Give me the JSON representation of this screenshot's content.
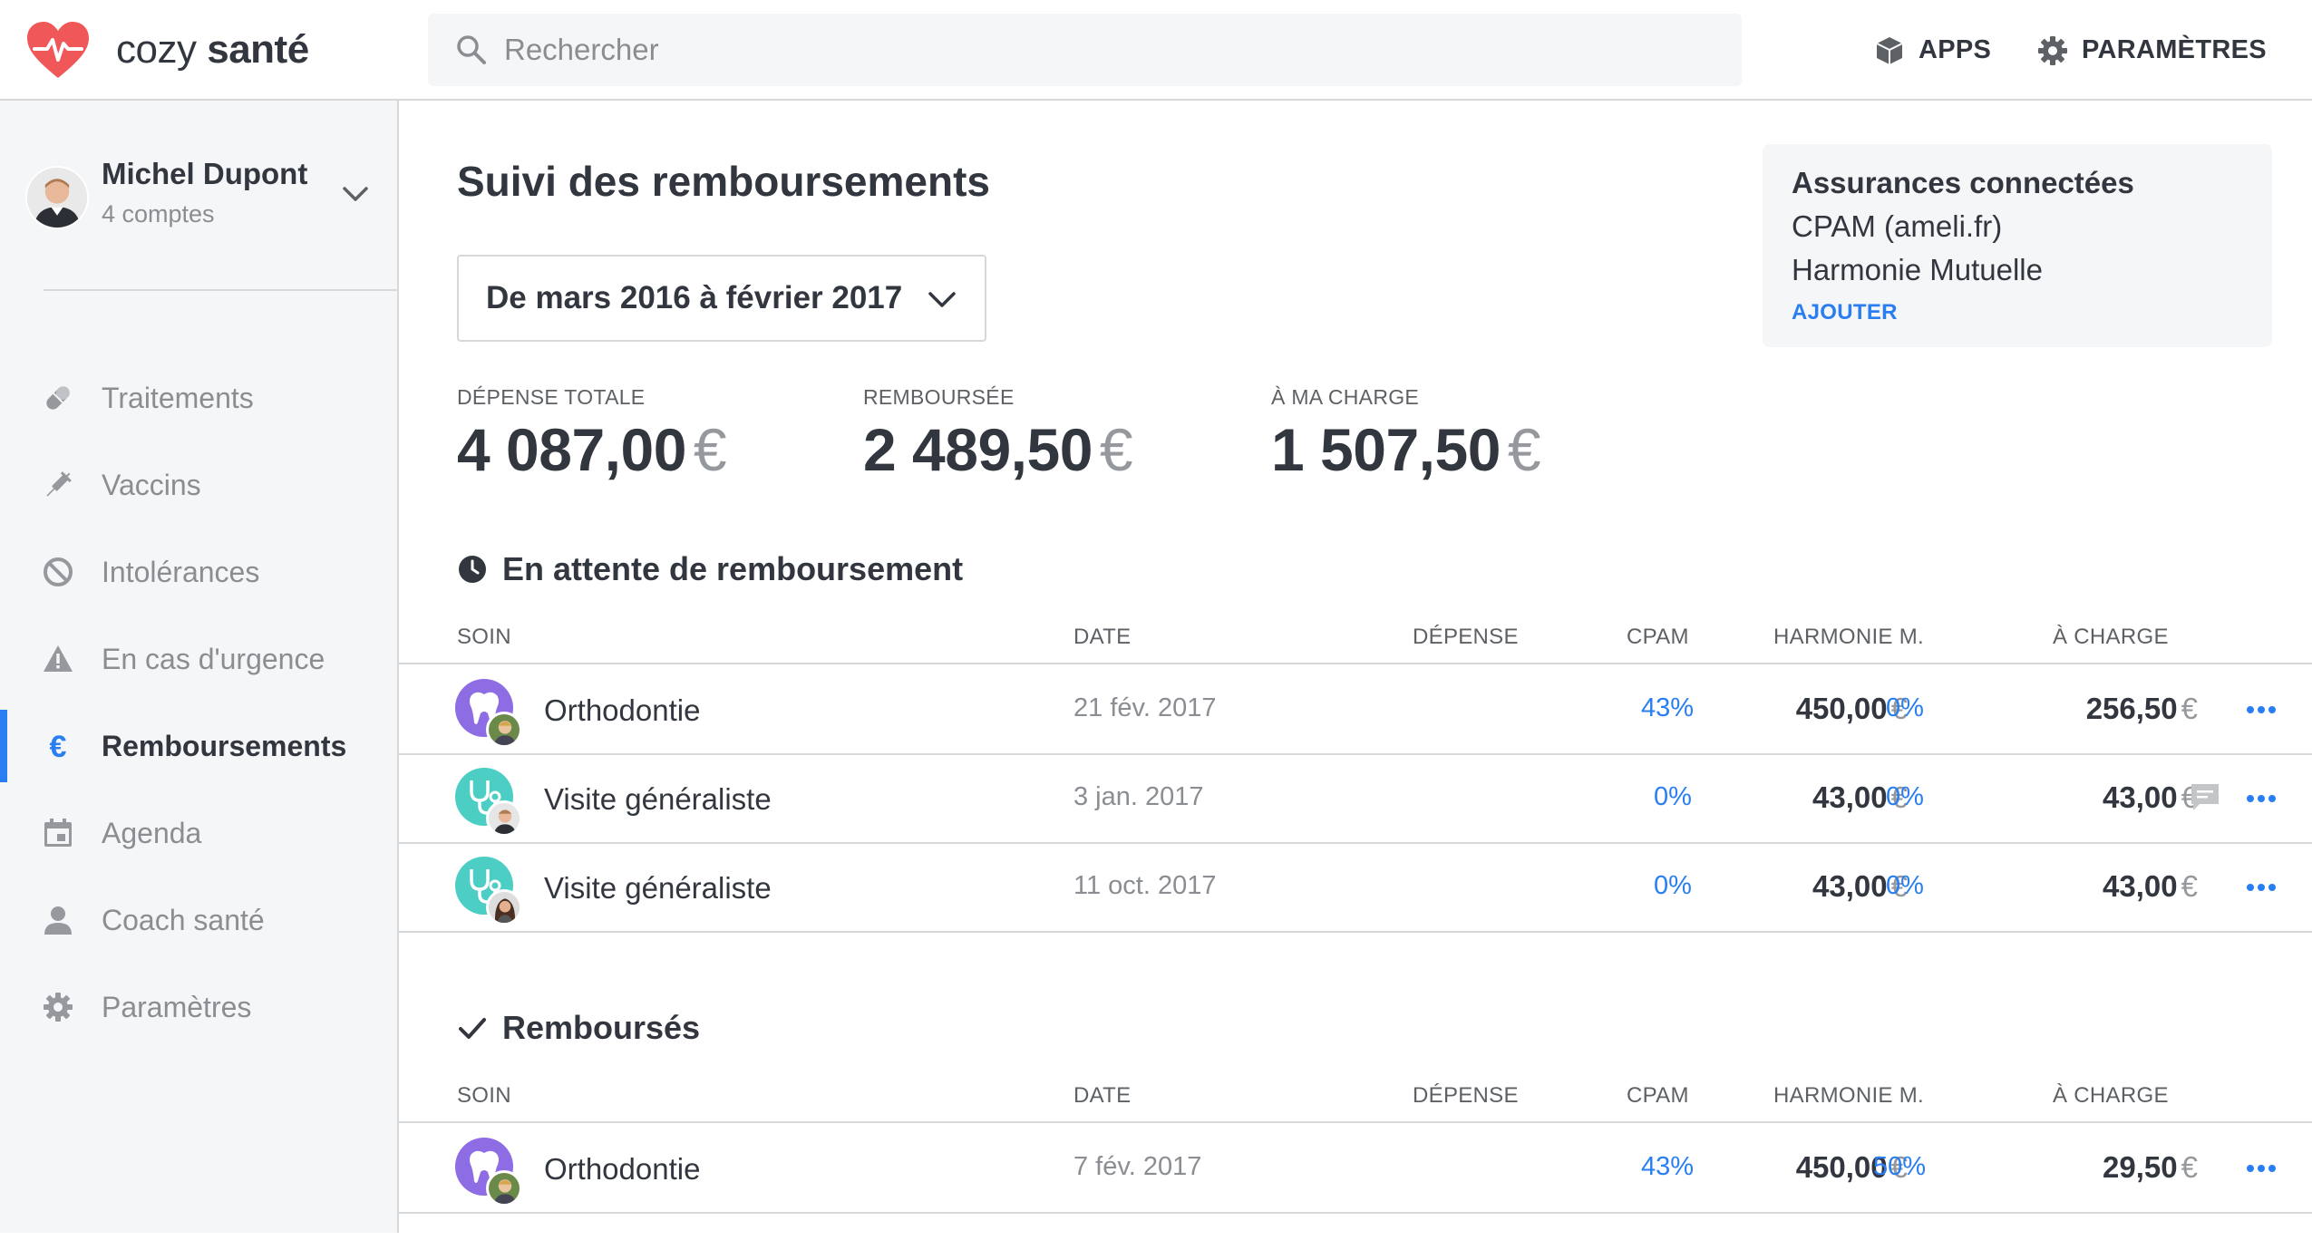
{
  "app": {
    "name_light": "cozy",
    "name_bold": "santé",
    "search_placeholder": "Rechercher",
    "apps_label": "APPS",
    "settings_label": "PARAMÈTRES",
    "accent_color": "#297ef2",
    "brand_color": "#f05759"
  },
  "profile": {
    "name": "Michel Dupont",
    "accounts": "4 comptes"
  },
  "sidebar": {
    "items": [
      {
        "label": "Traitements",
        "icon": "pill-icon",
        "active": false
      },
      {
        "label": "Vaccins",
        "icon": "syringe-icon",
        "active": false
      },
      {
        "label": "Intolérances",
        "icon": "forbidden-icon",
        "active": false
      },
      {
        "label": "En cas d'urgence",
        "icon": "warning-icon",
        "active": false
      },
      {
        "label": "Remboursements",
        "icon": "euro-icon",
        "active": true
      },
      {
        "label": "Agenda",
        "icon": "calendar-icon",
        "active": false
      },
      {
        "label": "Coach santé",
        "icon": "person-icon",
        "active": false
      },
      {
        "label": "Paramètres",
        "icon": "gear-icon",
        "active": false
      }
    ]
  },
  "main": {
    "title": "Suivi des remboursements",
    "period": "De mars 2016 à février 2017",
    "insurance": {
      "title": "Assurances connectées",
      "items": [
        "CPAM (ameli.fr)",
        "Harmonie Mutuelle"
      ],
      "add_label": "AJOUTER"
    },
    "stats": [
      {
        "label": "DÉPENSE TOTALE",
        "value": "4 087,00",
        "currency": "€"
      },
      {
        "label": "REMBOURSÉE",
        "value": "2 489,50",
        "currency": "€"
      },
      {
        "label": "À MA CHARGE",
        "value": "1 507,50",
        "currency": "€"
      }
    ],
    "columns": {
      "soin": "SOIN",
      "date": "DATE",
      "depense": "DÉPENSE",
      "cpam": "CPAM",
      "harmonie": "HARMONIE M.",
      "charge": "À CHARGE"
    },
    "pending": {
      "title": "En attente de remboursement",
      "rows": [
        {
          "soin": "Orthodontie",
          "date": "21 fév. 2017",
          "depense": "450,00",
          "cpam": "43%",
          "harmonie": "0%",
          "charge": "256,50",
          "currency": "€",
          "icon": "tooth-icon",
          "color": "#8e6ce3"
        },
        {
          "soin": "Visite généraliste",
          "date": "3 jan. 2017",
          "depense": "43,00",
          "cpam": "0%",
          "harmonie": "0%",
          "charge": "43,00",
          "currency": "€",
          "icon": "stethoscope-icon",
          "color": "#4dcec5"
        },
        {
          "soin": "Visite généraliste",
          "date": "11 oct. 2017",
          "depense": "43,00",
          "cpam": "0%",
          "harmonie": "0%",
          "charge": "43,00",
          "currency": "€",
          "icon": "stethoscope-icon",
          "color": "#4dcec5"
        }
      ]
    },
    "reimbursed": {
      "title": "Remboursés",
      "rows": [
        {
          "soin": "Orthodontie",
          "date": "7 fév. 2017",
          "depense": "450,00",
          "cpam": "43%",
          "harmonie": "50%",
          "charge": "29,50",
          "currency": "€",
          "icon": "tooth-icon",
          "color": "#8e6ce3"
        }
      ]
    }
  }
}
